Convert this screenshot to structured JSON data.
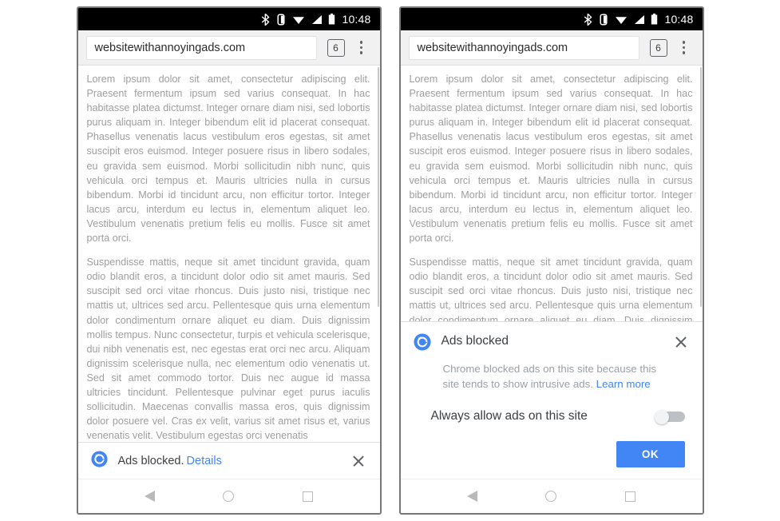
{
  "status_bar": {
    "time": "10:48",
    "icons": [
      "bluetooth-icon",
      "vibrate-icon",
      "wifi-icon",
      "signal-icon",
      "battery-icon"
    ]
  },
  "toolbar": {
    "url": "websitewithannoyingads.com",
    "tab_count": "6",
    "overflow_label": "More options"
  },
  "page": {
    "paragraph1": "Lorem ipsum dolor sit amet, consectetur adipiscing elit. Praesent fermentum ipsum sed varius consequat. In hac habitasse platea dictumst. Integer ornare diam nisi, sed lobortis purus aliquam in. Integer bibendum elit id placerat consequat. Phasellus venenatis lacus vestibulum eros egestas, sit amet suscipit eros euismod. Integer posuere risus in libero sodales, eu gravida sem euismod. Morbi sollicitudin nibh nunc, quis vehicula orci tempus et. Mauris ultricies nulla in cursus bibendum. Morbi id tincidunt arcu, non efficitur tortor. Integer lacus arcu, interdum eu lectus in, elementum aliquet leo. Vestibulum venenatis pretium felis eu mollis. Fusce sit amet porta orci.",
    "paragraph2": "Suspendisse mattis, neque sit amet tincidunt gravida, quam odio blandit eros, a tincidunt dolor odio sit amet mauris. Sed suscipit sed orci vitae rhoncus. Duis justo nisi, tristique nec mattis ut, ultrices sed arcu. Pellentesque quis urna elementum dolor condimentum ornare aliquet eu diam. Duis dignissim mollis tempus. Nunc consectetur, turpis et vehicula scelerisque, dui nibh venenatis est, nec egestas erat orci nec arcu. Aliquam dignissim scelerisque nulla, nec elementum odio venenatis ut. Sed sit amet commodo tortor. Duis nec augue id massa ultricies tincidunt. Pellentesque pulvinar eget purus iaculis sollicitudin. Maecenas convallis massa eros, quis dignissim dolor posuere vel. Cras ex velit, varius sit amet risus et, varius venenatis velit. Vestibulum egestas orci venenatis"
  },
  "snackbar": {
    "icon": "chrome-logo-icon",
    "message": "Ads blocked.",
    "link": "Details",
    "close_label": "Close"
  },
  "dialog": {
    "icon": "chrome-logo-icon",
    "title": "Ads blocked",
    "body_text": "Chrome blocked ads on this site because this site tends to show intrusive ads.",
    "body_link": "Learn more",
    "toggle_label": "Always allow ads on this site",
    "toggle_state": "off",
    "ok_label": "OK",
    "close_label": "Close"
  },
  "nav_bar": {
    "back": "back-button",
    "home": "home-button",
    "recents": "recents-button"
  },
  "colors": {
    "accent_blue": "#4285f4",
    "toolbar_gray": "#f1f1f1",
    "body_text_gray": "#9e9e9e",
    "status_bar_black": "#000000"
  }
}
